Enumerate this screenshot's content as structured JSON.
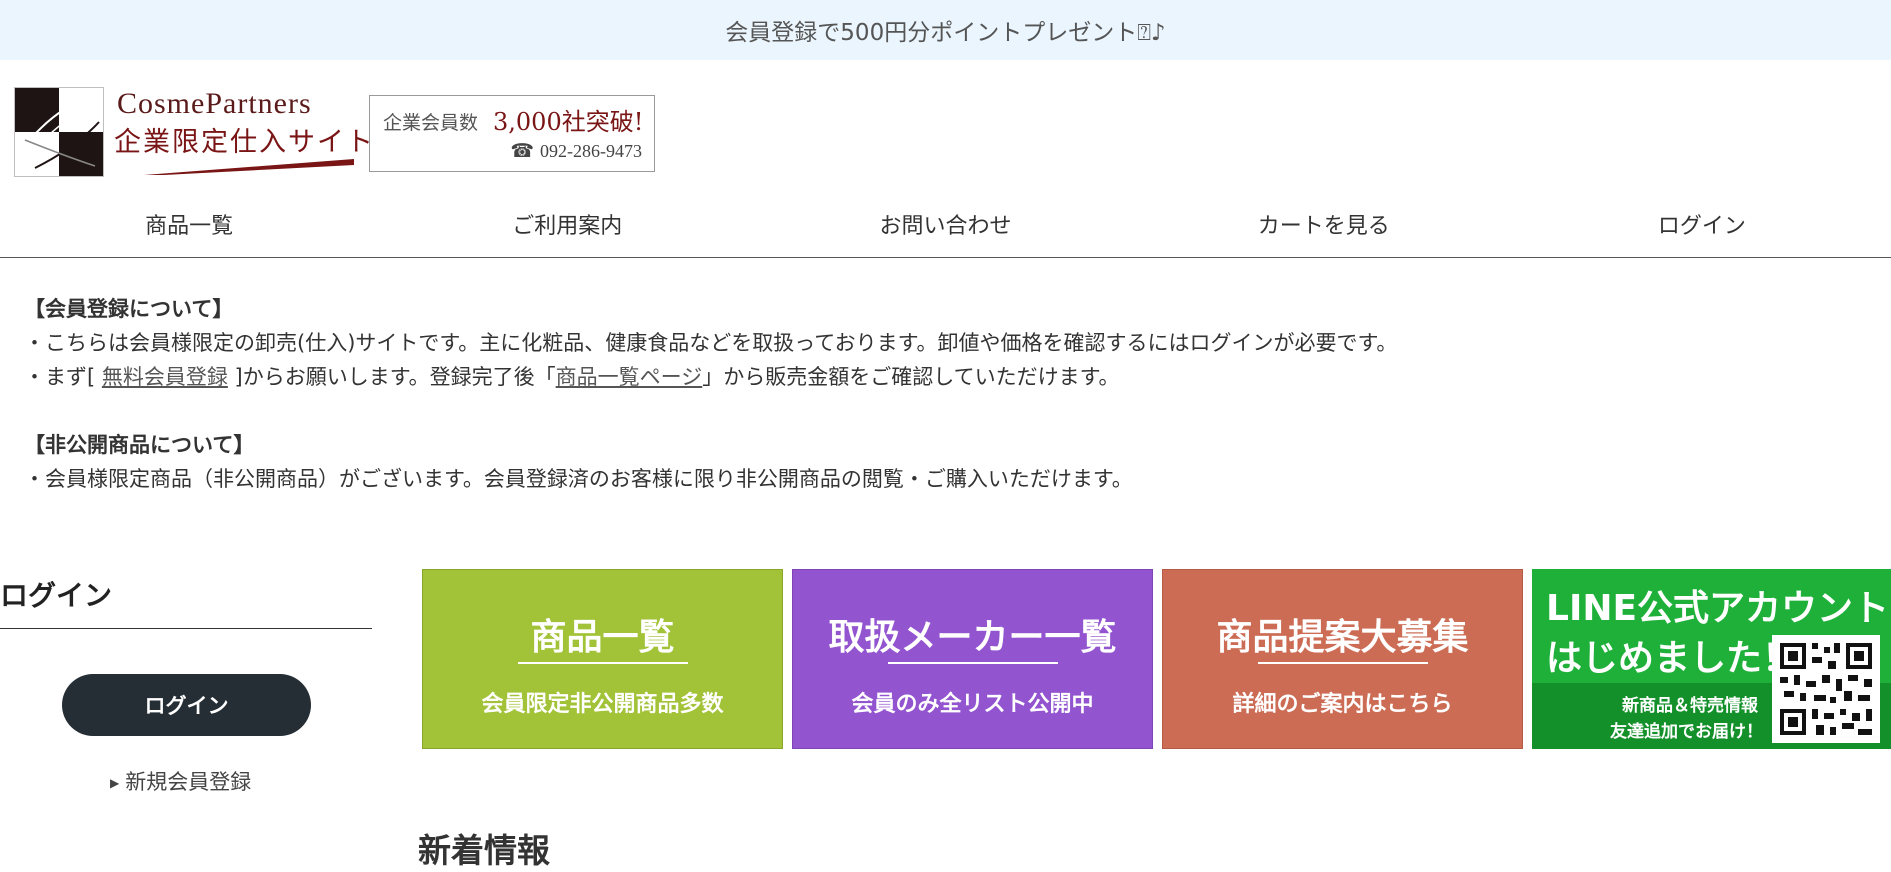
{
  "topbar": {
    "announcement": "会員登録で500円分ポイントプレゼント⍰♪"
  },
  "header": {
    "logo": {
      "en": "CosmePartners",
      "jp": "企業限定仕入サイト"
    },
    "badge": {
      "label": "企業会員数",
      "count": "3,000社突破!",
      "phone": "092-286-9473"
    }
  },
  "nav": {
    "items": [
      {
        "label": "商品一覧"
      },
      {
        "label": "ご利用案内"
      },
      {
        "label": "お問い合わせ"
      },
      {
        "label": "カートを見る"
      },
      {
        "label": "ログイン"
      }
    ]
  },
  "info": {
    "membership": {
      "heading": "【会員登録について】",
      "line1": "・こちらは会員様限定の卸売(仕入)サイトです。主に化粧品、健康食品などを取扱っております。卸値や価格を確認するにはログインが必要です。",
      "line2_prefix": "・まず[ ",
      "line2_link1": "無料会員登録",
      "line2_mid": " ]からお願いします。登録完了後「",
      "line2_link2": "商品一覧ページ",
      "line2_suffix": "」から販売金額をご確認していただけます。"
    },
    "private_items": {
      "heading": "【非公開商品について】",
      "line1": "・会員様限定商品（非公開商品）がございます。会員登録済のお客様に限り非公開商品の閲覧・ご購入いただけます。"
    }
  },
  "login": {
    "title": "ログイン",
    "button": "ログイン",
    "register_link": "新規会員登録"
  },
  "banners": [
    {
      "title": "商品一覧",
      "subtitle": "会員限定非公開商品多数",
      "color": "#a2c237"
    },
    {
      "title": "取扱メーカー一覧",
      "subtitle": "会員のみ全リスト公開中",
      "color": "#9354d0"
    },
    {
      "title": "商品提案大募集",
      "subtitle": "詳細のご案内はこちら",
      "color": "#cc6c54"
    }
  ],
  "line_banner": {
    "line1": "LINE公式アカウント",
    "line2": "はじめました！",
    "line3": "新商品＆特売情報",
    "line4": "友達追加でお届け！",
    "color": "#1fb03a"
  },
  "news": {
    "title": "新着情報"
  }
}
